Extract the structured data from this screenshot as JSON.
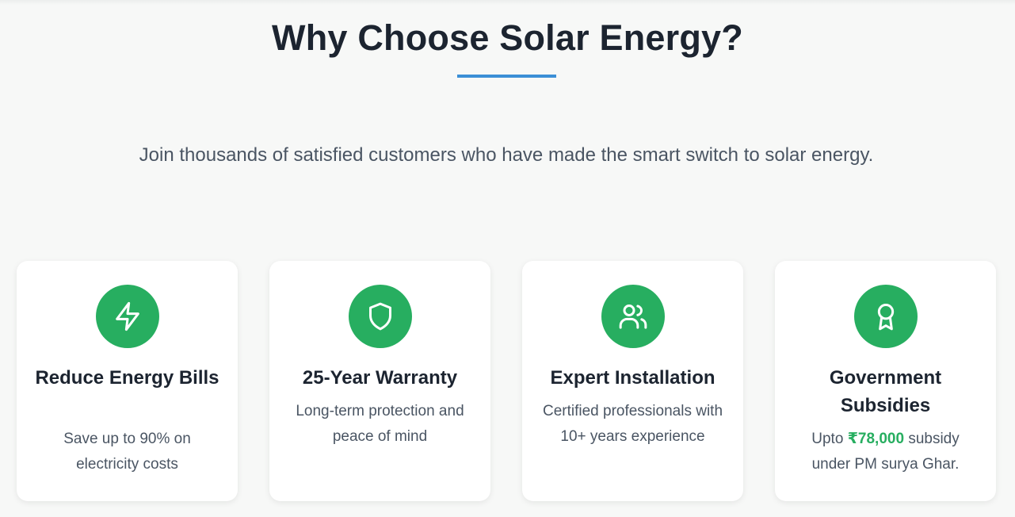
{
  "section": {
    "title": "Why Choose Solar Energy?",
    "intro": "Join thousands of satisfied customers who have made the smart switch to solar energy."
  },
  "colors": {
    "accent_underline": "#3b8fd6",
    "icon_circle": "#27ae60",
    "highlight": "#27ae60"
  },
  "cards": [
    {
      "icon": "lightning-bolt-icon",
      "title": "Reduce Energy Bills",
      "description": "Save up to 90% on electricity costs"
    },
    {
      "icon": "shield-icon",
      "title": "25-Year Warranty",
      "description": "Long-term protection and peace of mind"
    },
    {
      "icon": "users-icon",
      "title": "Expert Installation",
      "description": "Certified professionals with 10+ years experience"
    },
    {
      "icon": "award-ribbon-icon",
      "title": "Government Subsidies",
      "description_prefix": "Upto",
      "description_highlight": "₹78,000",
      "description_suffix": "subsidy under PM surya Ghar."
    }
  ]
}
